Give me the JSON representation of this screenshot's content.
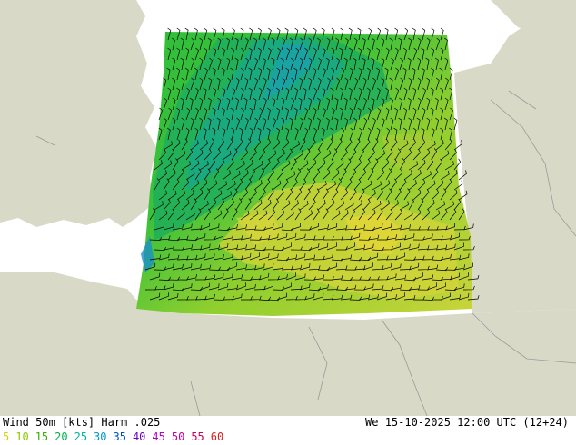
{
  "title": "Wind 50m [kts] Harm .025",
  "datetime": "We 15-10-2025 12:00 UTC (12+24)",
  "legend": [
    {
      "value": "5",
      "color": "#d4d400"
    },
    {
      "value": "10",
      "color": "#8cc800"
    },
    {
      "value": "15",
      "color": "#33b000"
    },
    {
      "value": "20",
      "color": "#00b44a"
    },
    {
      "value": "25",
      "color": "#00b4a0"
    },
    {
      "value": "30",
      "color": "#0096c8"
    },
    {
      "value": "35",
      "color": "#0050c8"
    },
    {
      "value": "40",
      "color": "#6a00c8"
    },
    {
      "value": "45",
      "color": "#b400c8"
    },
    {
      "value": "50",
      "color": "#c80096"
    },
    {
      "value": "55",
      "color": "#c8005a"
    },
    {
      "value": "60",
      "color": "#dc1e1e"
    }
  ],
  "colors": {
    "land": "#d9d9c8",
    "sea": "#ffffff",
    "border": "#9a9a9a",
    "barb": "#000000"
  }
}
